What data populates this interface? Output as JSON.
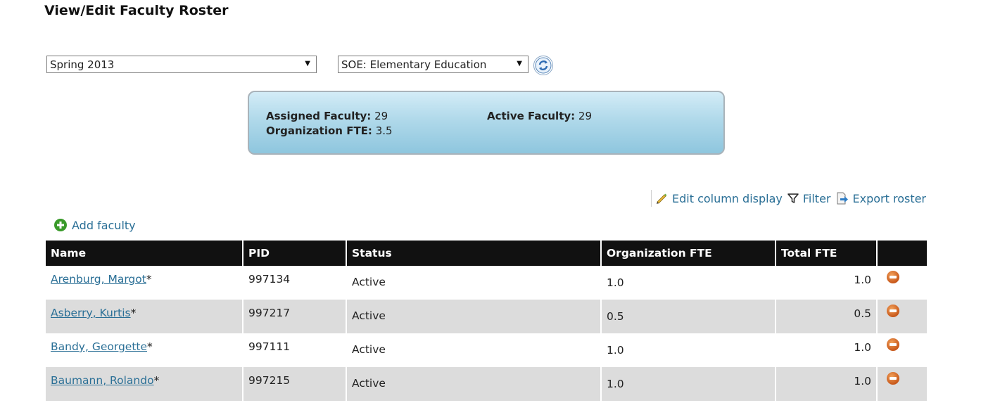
{
  "page": {
    "title": "View/Edit Faculty Roster"
  },
  "filters": {
    "term": "Spring 2013",
    "organization": "SOE: Elementary Education"
  },
  "summary": {
    "assigned_label": "Assigned Faculty:",
    "assigned_value": "29",
    "active_label": "Active Faculty:",
    "active_value": "29",
    "fte_label": "Organization FTE:",
    "fte_value": "3.5"
  },
  "toolbar": {
    "edit_columns": "Edit column display",
    "filter": "Filter",
    "export": "Export roster"
  },
  "add_faculty": "Add faculty",
  "table": {
    "columns": [
      "Name",
      "PID",
      "Status",
      "Organization FTE",
      "Total FTE",
      ""
    ],
    "rows": [
      {
        "name": "Arenburg, Margot",
        "marker": "*",
        "pid": "997134",
        "status": "Active",
        "org_fte": "1.0",
        "total_fte": "1.0"
      },
      {
        "name": "Asberry, Kurtis",
        "marker": "*",
        "pid": "997217",
        "status": "Active",
        "org_fte": "0.5",
        "total_fte": "0.5"
      },
      {
        "name": "Bandy, Georgette",
        "marker": "*",
        "pid": "997111",
        "status": "Active",
        "org_fte": "1.0",
        "total_fte": "1.0"
      },
      {
        "name": "Baumann, Rolando",
        "marker": "*",
        "pid": "997215",
        "status": "Active",
        "org_fte": "1.0",
        "total_fte": "1.0"
      }
    ]
  },
  "icons": {
    "refresh": "refresh-icon",
    "edit": "pencil-icon",
    "filter": "funnel-icon",
    "export": "export-icon",
    "add": "plus-circle-icon",
    "remove": "minus-circle-icon"
  },
  "colors": {
    "link": "#2a6f96",
    "header_bg": "#111111",
    "row_alt": "#dcdcdc",
    "remove": "#c8581a",
    "add": "#3a9a2a"
  }
}
